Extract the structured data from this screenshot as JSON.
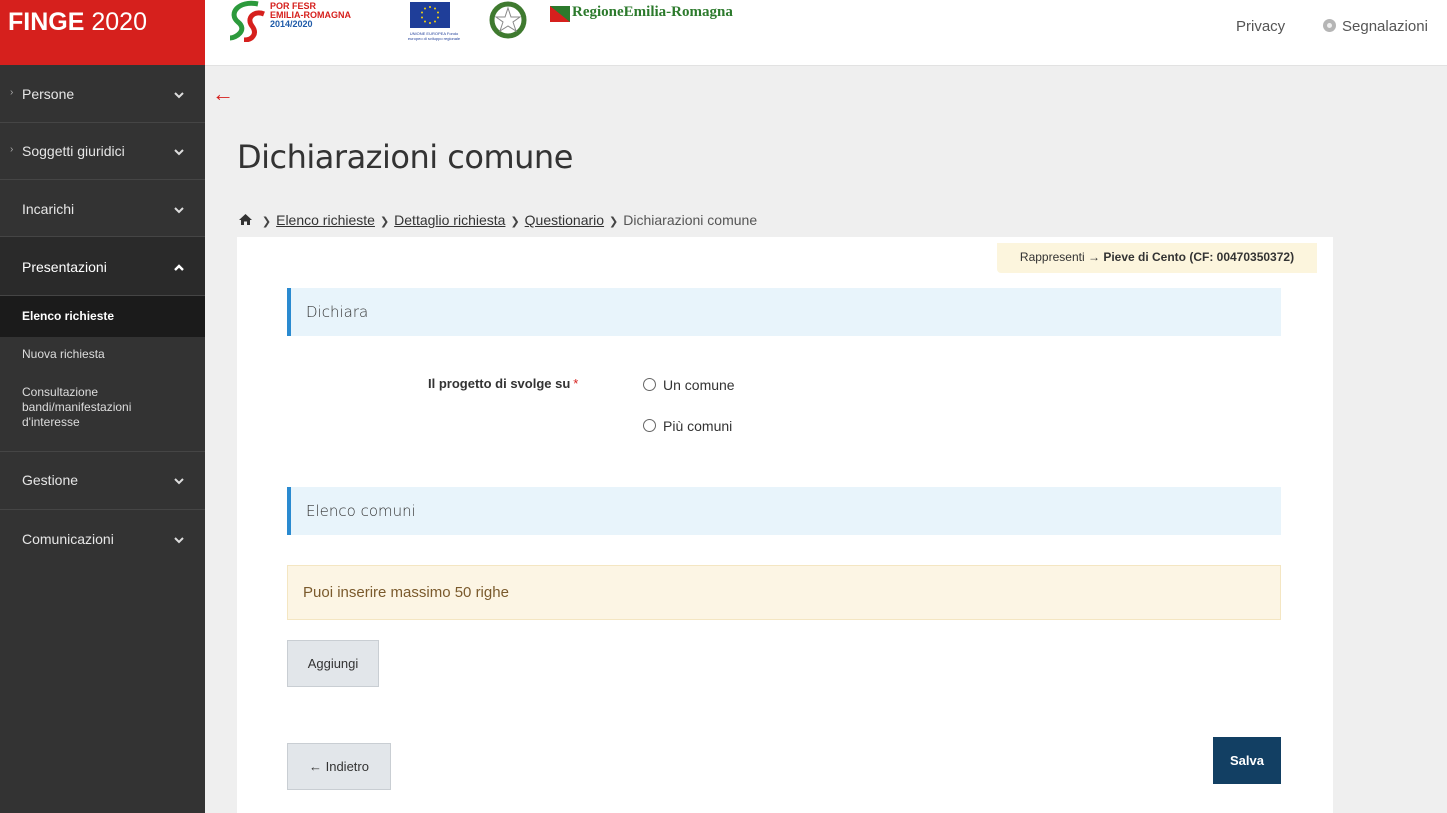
{
  "header": {
    "brand_name": "FINGE",
    "brand_year": "2020",
    "logo_porfesr": [
      "POR FESR",
      "EMILIA-ROMAGNA",
      "2014/2020"
    ],
    "logo_ue_caption": "UNIONE EUROPEA Fondo europeo di sviluppo regionale",
    "logo_rer": "RegioneEmilia-Romagna",
    "privacy_label": "Privacy",
    "segnalazioni_label": "Segnalazioni"
  },
  "sidebar": {
    "items": [
      {
        "label": "Persone"
      },
      {
        "label": "Soggetti giuridici"
      },
      {
        "label": "Incarichi"
      },
      {
        "label": "Presentazioni"
      },
      {
        "label": "Gestione"
      },
      {
        "label": "Comunicazioni"
      }
    ],
    "subitems": [
      {
        "label": "Elenco richieste"
      },
      {
        "label": "Nuova richiesta"
      },
      {
        "label": "Consultazione bandi/manifestazioni d'interesse"
      }
    ]
  },
  "page": {
    "arrow": "←",
    "title": "Dichiarazioni comune",
    "breadcrumb": [
      "Elenco richieste",
      "Dettaglio richiesta",
      "Questionario",
      "Dichiarazioni comune"
    ],
    "rappresenti_prefix": "Rappresenti",
    "rappresenti_arrow": "→",
    "rappresenti_value": "Pieve di Cento (CF: 00470350372)",
    "section_dichiara": "Dichiara",
    "question_label": "Il progetto di svolge su",
    "required_mark": "*",
    "options": [
      "Un comune",
      "Più comuni"
    ],
    "section_elenco": "Elenco comuni",
    "warning": "Puoi inserire massimo 50 righe",
    "add_button": "Aggiungi",
    "back_button": "← Indietro",
    "save_button": "Salva"
  },
  "colors": {
    "brand_red": "#d6201d",
    "sidebar_bg": "#333333",
    "section_accent": "#2a8ad0",
    "save_button": "#123f63"
  }
}
